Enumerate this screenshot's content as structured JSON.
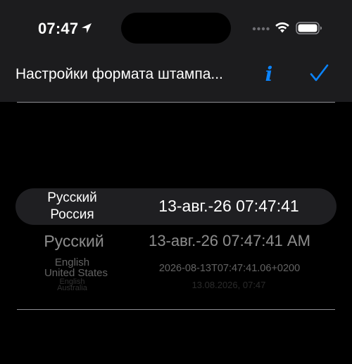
{
  "status_bar": {
    "time": "07:47",
    "icons": [
      "location-arrow-icon",
      "cellular-signal-icon",
      "wifi-icon",
      "battery-icon"
    ]
  },
  "nav": {
    "title": "Настройки формата штампа...",
    "info_icon": "i",
    "done_icon": "checkmark-icon",
    "accent_color": "#0a84ff"
  },
  "picker": {
    "rows": [
      {
        "language": "Русский",
        "region": "Россия",
        "sample": "13-авг.-26 07:47:41",
        "selected": true
      },
      {
        "language": "Русский",
        "region": "",
        "sample": "13-авг.-26 07:47:41 AM",
        "selected": false
      },
      {
        "language": "English",
        "region": "United States",
        "sample": "2026-08-13T07:47:41.06+0200",
        "selected": false
      },
      {
        "language": "English",
        "region": "Australia",
        "sample": "13.08.2026, 07:47",
        "selected": false
      }
    ]
  }
}
